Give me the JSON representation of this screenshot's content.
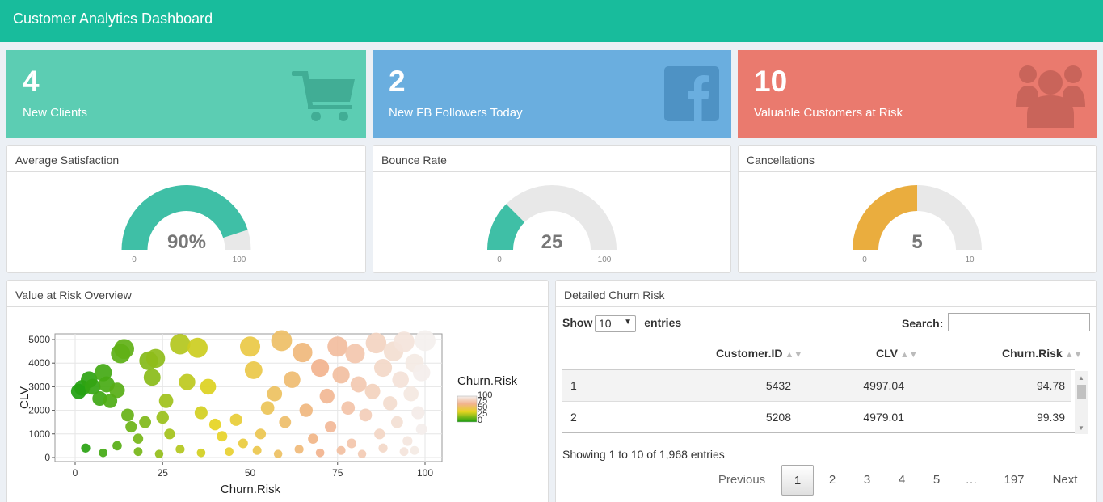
{
  "header": {
    "title": "Customer Analytics Dashboard"
  },
  "value_boxes": [
    {
      "value": "4",
      "subtitle": "New Clients",
      "color": "#5ccdb3",
      "icon": "shopping-cart-icon"
    },
    {
      "value": "2",
      "subtitle": "New FB Followers Today",
      "color": "#6aaedf",
      "icon": "facebook-icon"
    },
    {
      "value": "10",
      "subtitle": "Valuable Customers at Risk",
      "color": "#ea7a6e",
      "icon": "users-icon"
    }
  ],
  "gauges": [
    {
      "title": "Average Satisfaction",
      "value": 90,
      "display": "90%",
      "min": 0,
      "max": 100,
      "min_label": "0",
      "max_label": "100",
      "color": "#3fbfa6"
    },
    {
      "title": "Bounce Rate",
      "value": 25,
      "display": "25",
      "min": 0,
      "max": 100,
      "min_label": "0",
      "max_label": "100",
      "color": "#3fbfa6"
    },
    {
      "title": "Cancellations",
      "value": 5,
      "display": "5",
      "min": 0,
      "max": 10,
      "min_label": "0",
      "max_label": "10",
      "color": "#eaad3e"
    }
  ],
  "scatter_panel": {
    "title": "Value at Risk Overview"
  },
  "chart_data": {
    "type": "scatter",
    "title": "",
    "xlabel": "Churn.Risk",
    "ylabel": "CLV",
    "xlim": [
      0,
      100
    ],
    "ylim": [
      0,
      5000
    ],
    "x_ticks": [
      0,
      25,
      50,
      75,
      100
    ],
    "y_ticks": [
      0,
      1000,
      2000,
      3000,
      4000,
      5000
    ],
    "x_tick_labels": [
      "0",
      "25",
      "50",
      "75",
      "100"
    ],
    "y_tick_labels": [
      "0",
      "1000",
      "2000",
      "3000",
      "4000",
      "5000"
    ],
    "grid": true,
    "color_by": "Churn.Risk",
    "size_by": "CLV",
    "legend": {
      "title": "Churn.Risk",
      "placement": "right",
      "labels": [
        "100",
        "75",
        "50",
        "25",
        "0"
      ],
      "colors": [
        "#f4f0ee",
        "#f2b38e",
        "#e6d421",
        "#1a9e10"
      ]
    },
    "points": [
      {
        "x": 1,
        "y": 2800
      },
      {
        "x": 2,
        "y": 2950
      },
      {
        "x": 4,
        "y": 3300
      },
      {
        "x": 5,
        "y": 3000
      },
      {
        "x": 7,
        "y": 2500
      },
      {
        "x": 8,
        "y": 3600
      },
      {
        "x": 9,
        "y": 3100
      },
      {
        "x": 10,
        "y": 2400
      },
      {
        "x": 12,
        "y": 2850
      },
      {
        "x": 13,
        "y": 4400
      },
      {
        "x": 14,
        "y": 4600
      },
      {
        "x": 15,
        "y": 1800
      },
      {
        "x": 16,
        "y": 1300
      },
      {
        "x": 18,
        "y": 800
      },
      {
        "x": 20,
        "y": 1500
      },
      {
        "x": 21,
        "y": 4100
      },
      {
        "x": 22,
        "y": 3400
      },
      {
        "x": 23,
        "y": 4200
      },
      {
        "x": 25,
        "y": 1700
      },
      {
        "x": 26,
        "y": 2400
      },
      {
        "x": 27,
        "y": 1000
      },
      {
        "x": 30,
        "y": 4800
      },
      {
        "x": 32,
        "y": 3200
      },
      {
        "x": 35,
        "y": 4650
      },
      {
        "x": 36,
        "y": 1900
      },
      {
        "x": 38,
        "y": 3000
      },
      {
        "x": 40,
        "y": 1400
      },
      {
        "x": 42,
        "y": 900
      },
      {
        "x": 46,
        "y": 1600
      },
      {
        "x": 48,
        "y": 600
      },
      {
        "x": 50,
        "y": 4700
      },
      {
        "x": 51,
        "y": 3700
      },
      {
        "x": 53,
        "y": 1000
      },
      {
        "x": 55,
        "y": 2100
      },
      {
        "x": 57,
        "y": 2700
      },
      {
        "x": 59,
        "y": 4950
      },
      {
        "x": 60,
        "y": 1500
      },
      {
        "x": 62,
        "y": 3300
      },
      {
        "x": 65,
        "y": 4450
      },
      {
        "x": 66,
        "y": 2000
      },
      {
        "x": 68,
        "y": 800
      },
      {
        "x": 70,
        "y": 3800
      },
      {
        "x": 72,
        "y": 2600
      },
      {
        "x": 73,
        "y": 1300
      },
      {
        "x": 75,
        "y": 4700
      },
      {
        "x": 76,
        "y": 3500
      },
      {
        "x": 78,
        "y": 2100
      },
      {
        "x": 79,
        "y": 600
      },
      {
        "x": 80,
        "y": 4400
      },
      {
        "x": 81,
        "y": 3100
      },
      {
        "x": 83,
        "y": 1800
      },
      {
        "x": 85,
        "y": 2800
      },
      {
        "x": 86,
        "y": 4850
      },
      {
        "x": 87,
        "y": 1000
      },
      {
        "x": 88,
        "y": 3800
      },
      {
        "x": 90,
        "y": 2300
      },
      {
        "x": 91,
        "y": 4500
      },
      {
        "x": 92,
        "y": 1500
      },
      {
        "x": 93,
        "y": 3300
      },
      {
        "x": 94,
        "y": 4900
      },
      {
        "x": 95,
        "y": 700
      },
      {
        "x": 96,
        "y": 2700
      },
      {
        "x": 97,
        "y": 4000
      },
      {
        "x": 98,
        "y": 1900
      },
      {
        "x": 99,
        "y": 3600
      },
      {
        "x": 100,
        "y": 4950
      },
      {
        "x": 99,
        "y": 1200
      },
      {
        "x": 97,
        "y": 300
      },
      {
        "x": 3,
        "y": 400
      },
      {
        "x": 8,
        "y": 200
      },
      {
        "x": 12,
        "y": 500
      },
      {
        "x": 18,
        "y": 250
      },
      {
        "x": 24,
        "y": 150
      },
      {
        "x": 30,
        "y": 350
      },
      {
        "x": 36,
        "y": 200
      },
      {
        "x": 44,
        "y": 250
      },
      {
        "x": 52,
        "y": 300
      },
      {
        "x": 58,
        "y": 150
      },
      {
        "x": 64,
        "y": 350
      },
      {
        "x": 70,
        "y": 200
      },
      {
        "x": 76,
        "y": 300
      },
      {
        "x": 82,
        "y": 150
      },
      {
        "x": 88,
        "y": 400
      },
      {
        "x": 94,
        "y": 250
      }
    ]
  },
  "table_panel": {
    "title": "Detailed Churn Risk",
    "show_label": "Show",
    "entries_value": "10",
    "entries_label": "entries",
    "search_label": "Search:",
    "search_value": "",
    "columns": [
      "",
      "Customer.ID",
      "CLV",
      "Churn.Risk"
    ],
    "rows": [
      [
        "1",
        "5432",
        "4997.04",
        "94.78"
      ],
      [
        "2",
        "5208",
        "4979.01",
        "99.39"
      ]
    ],
    "info": "Showing 1 to 10 of 1,968 entries",
    "pagination": [
      "Previous",
      "1",
      "2",
      "3",
      "4",
      "5",
      "…",
      "197",
      "Next"
    ]
  }
}
